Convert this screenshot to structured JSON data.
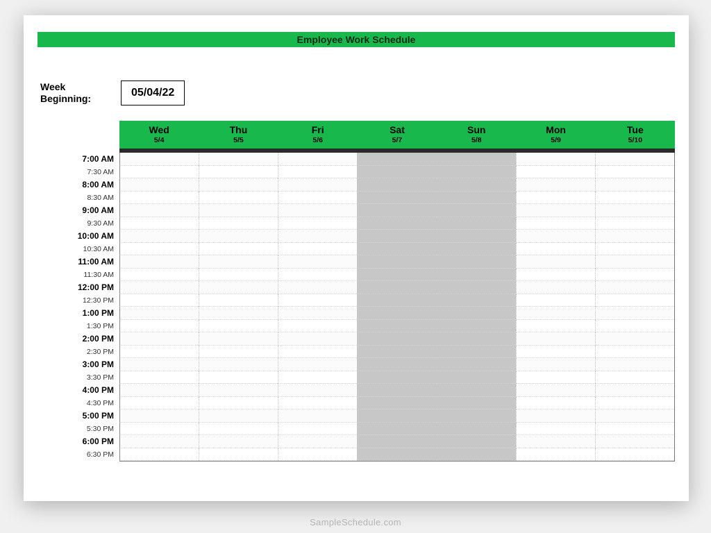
{
  "title": "Employee Work Schedule",
  "week_label": "Week\nBeginning:",
  "week_date": "05/04/22",
  "days": [
    {
      "name": "Wed",
      "date": "5/4",
      "weekend": false
    },
    {
      "name": "Thu",
      "date": "5/5",
      "weekend": false
    },
    {
      "name": "Fri",
      "date": "5/6",
      "weekend": false
    },
    {
      "name": "Sat",
      "date": "5/7",
      "weekend": true
    },
    {
      "name": "Sun",
      "date": "5/8",
      "weekend": true
    },
    {
      "name": "Mon",
      "date": "5/9",
      "weekend": false
    },
    {
      "name": "Tue",
      "date": "5/10",
      "weekend": false
    }
  ],
  "times": [
    {
      "label": "7:00 AM",
      "hour": true
    },
    {
      "label": "7:30 AM",
      "hour": false
    },
    {
      "label": "8:00 AM",
      "hour": true
    },
    {
      "label": "8:30 AM",
      "hour": false
    },
    {
      "label": "9:00 AM",
      "hour": true
    },
    {
      "label": "9:30 AM",
      "hour": false
    },
    {
      "label": "10:00 AM",
      "hour": true
    },
    {
      "label": "10:30 AM",
      "hour": false
    },
    {
      "label": "11:00 AM",
      "hour": true
    },
    {
      "label": "11:30 AM",
      "hour": false
    },
    {
      "label": "12:00 PM",
      "hour": true
    },
    {
      "label": "12:30 PM",
      "hour": false
    },
    {
      "label": "1:00 PM",
      "hour": true
    },
    {
      "label": "1:30 PM",
      "hour": false
    },
    {
      "label": "2:00 PM",
      "hour": true
    },
    {
      "label": "2:30 PM",
      "hour": false
    },
    {
      "label": "3:00 PM",
      "hour": true
    },
    {
      "label": "3:30 PM",
      "hour": false
    },
    {
      "label": "4:00 PM",
      "hour": true
    },
    {
      "label": "4:30 PM",
      "hour": false
    },
    {
      "label": "5:00 PM",
      "hour": true
    },
    {
      "label": "5:30 PM",
      "hour": false
    },
    {
      "label": "6:00 PM",
      "hour": true
    },
    {
      "label": "6:30 PM",
      "hour": false
    }
  ],
  "watermark": "SampleSchedule.com"
}
